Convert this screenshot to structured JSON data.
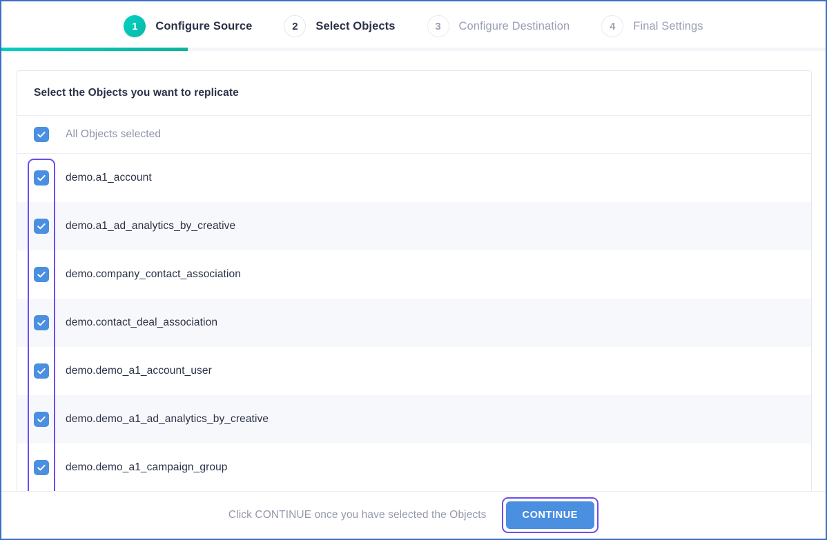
{
  "stepper": {
    "steps": [
      {
        "number": "1",
        "label": "Configure Source",
        "state": "active"
      },
      {
        "number": "2",
        "label": "Select Objects",
        "state": "next"
      },
      {
        "number": "3",
        "label": "Configure Destination",
        "state": "inactive"
      },
      {
        "number": "4",
        "label": "Final Settings",
        "state": "inactive"
      }
    ],
    "progress_percent": "23"
  },
  "card": {
    "title": "Select the Objects you want to replicate",
    "select_all": {
      "label": "All Objects selected",
      "checked": true
    },
    "objects": [
      {
        "label": "demo.a1_account",
        "checked": true
      },
      {
        "label": "demo.a1_ad_analytics_by_creative",
        "checked": true
      },
      {
        "label": "demo.company_contact_association",
        "checked": true
      },
      {
        "label": "demo.contact_deal_association",
        "checked": true
      },
      {
        "label": "demo.demo_a1_account_user",
        "checked": true
      },
      {
        "label": "demo.demo_a1_ad_analytics_by_creative",
        "checked": true
      },
      {
        "label": "demo.demo_a1_campaign_group",
        "checked": true
      }
    ]
  },
  "footer": {
    "hint": "Click CONTINUE once you have selected the Objects",
    "continue_label": "CONTINUE"
  },
  "colors": {
    "accent_teal": "#00cfc3",
    "checkbox_blue": "#4a8fe0",
    "focus_purple": "#6c4bf4",
    "row_alt": "#f7f8fc",
    "text_dark": "#2b3147",
    "text_muted": "#9499ac"
  }
}
